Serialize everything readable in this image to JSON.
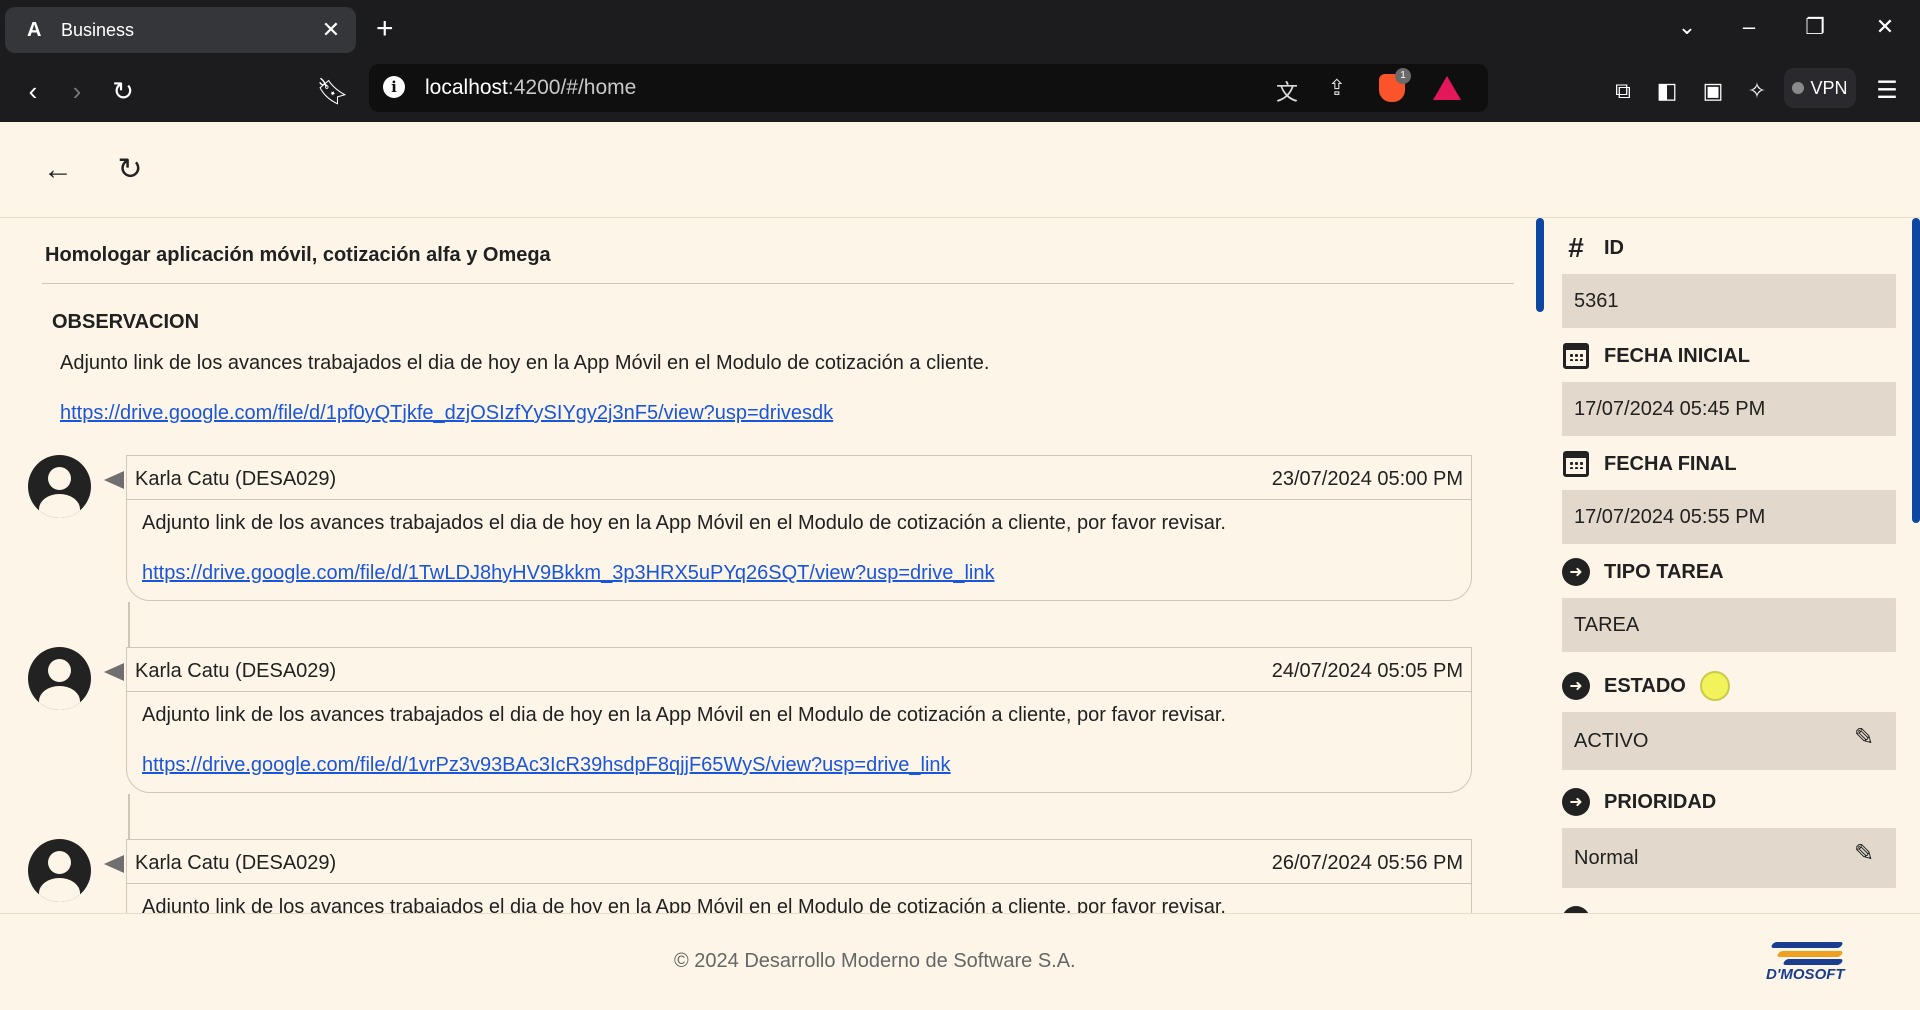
{
  "browser": {
    "tab_title": "Business",
    "tab_favicon": "A",
    "url_host": "localhost",
    "url_path": ":4200/#/home",
    "vpn_label": "VPN",
    "brave_badge": "1"
  },
  "task": {
    "title": "Homologar aplicación móvil, cotización alfa y Omega",
    "observation_heading": "OBSERVACION",
    "observation_text": "Adjunto link de los avances trabajados el dia de hoy en la App Móvil en el Modulo de cotización a cliente.",
    "observation_link": "https://drive.google.com/file/d/1pf0yQTjkfe_dzjOSIzfYySIYgy2j3nF5/view?usp=drivesdk"
  },
  "comments": [
    {
      "author": "Karla Catu (DESA029)",
      "date": "23/07/2024 05:00 PM",
      "text": "Adjunto link de los avances trabajados el dia de hoy en la App Móvil en el Modulo de cotización a cliente, por favor revisar.",
      "link": "https://drive.google.com/file/d/1TwLDJ8hyHV9Bkkm_3p3HRX5uPYq26SQT/view?usp=drive_link"
    },
    {
      "author": "Karla Catu (DESA029)",
      "date": "24/07/2024 05:05 PM",
      "text": "Adjunto link de los avances trabajados el dia de hoy en la App Móvil en el Modulo de cotización a cliente, por favor revisar.",
      "link": "https://drive.google.com/file/d/1vrPz3v93BAc3IcR39hsdpF8qjjF65WyS/view?usp=drive_link"
    },
    {
      "author": "Karla Catu (DESA029)",
      "date": "26/07/2024 05:56 PM",
      "text": "Adjunto link de los avances trabajados el dia de hoy en la App Móvil en el Modulo de cotización a cliente, por favor revisar.",
      "link": ""
    }
  ],
  "details": {
    "id_label": "ID",
    "id_value": "5361",
    "fecha_inicial_label": "FECHA INICIAL",
    "fecha_inicial_value": "17/07/2024 05:45 PM",
    "fecha_final_label": "FECHA FINAL",
    "fecha_final_value": "17/07/2024 05:55 PM",
    "tipo_label": "TIPO TAREA",
    "tipo_value": "TAREA",
    "estado_label": "ESTADO",
    "estado_value": "ACTIVO",
    "estado_color": "#f2f25a",
    "prioridad_label": "PRIORIDAD",
    "prioridad_value": "Normal"
  },
  "footer": {
    "copyright": "© 2024 Desarrollo Moderno de Software S.A.",
    "logo_text": "D'MOSOFT"
  },
  "icons": {
    "back": "arrow-left-icon",
    "refresh": "refresh-icon",
    "id": "hash-icon",
    "date": "calendar-icon",
    "arrow": "arrow-circle-right-icon",
    "edit": "pencil-icon"
  }
}
